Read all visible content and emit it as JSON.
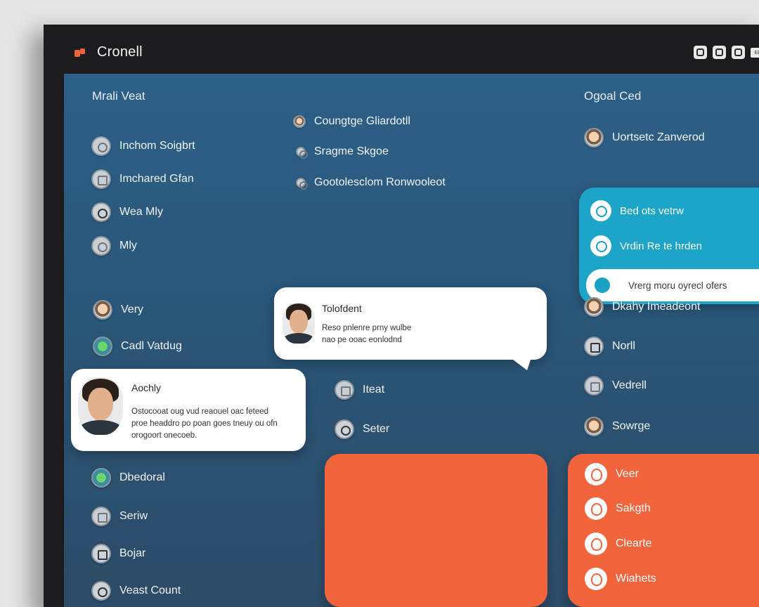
{
  "app": {
    "title": "Cronell"
  },
  "titlebar": {
    "badge_text": "EEE"
  },
  "left": {
    "heading": "Mrali Veat",
    "items": [
      {
        "label": "Inchom Soigbrt",
        "icon": "target-icon"
      },
      {
        "label": "Imchared Gfan",
        "icon": "grid-icon"
      },
      {
        "label": "Wea Mly",
        "icon": "chat-icon"
      },
      {
        "label": "Mly",
        "icon": "circle-icon"
      },
      {
        "label": "Very",
        "icon": "avatar-icon"
      },
      {
        "label": "Cadl Vatdug",
        "icon": "list-icon"
      }
    ],
    "lower_items": [
      {
        "label": "Dbedoral",
        "icon": "green-dot-icon"
      },
      {
        "label": "Seriw",
        "icon": "document-icon"
      },
      {
        "label": "Bojar",
        "icon": "calendar-icon"
      },
      {
        "label": "Veast Count",
        "icon": "counter-icon"
      }
    ]
  },
  "middle": {
    "items": [
      {
        "label": "Coungtge Gliardotll",
        "icon": "avatar-icon"
      },
      {
        "label": "Sragme Skgoe",
        "icon": "gear-icon"
      },
      {
        "label": "Gootolesclom Ronwooleot",
        "icon": "info-icon"
      }
    ],
    "lower_items": [
      {
        "label": "Iteat",
        "icon": "folder-icon"
      },
      {
        "label": "Seter",
        "icon": "settings-icon"
      }
    ]
  },
  "cards": {
    "top": {
      "name": "Tolofdent",
      "lines": [
        "Reso pnlenre prny wulbe",
        "nao pe ooac eonlodnd"
      ]
    },
    "left": {
      "name": "Aochly",
      "lines": [
        "Ostocooat oug vud reaouel oac feteed",
        "proe headdro po poan goes tneuy ou ofn",
        "orogoort onecoeb."
      ]
    }
  },
  "right": {
    "heading": "Ogoal Ced",
    "top_item": {
      "label": "Uortsetc Zanverod",
      "icon": "avatar-icon"
    },
    "teal_items": [
      {
        "label": "Bed ots vetrw",
        "icon": "chat-bubble-icon"
      },
      {
        "label": "Vrdin Re te hrden",
        "icon": "chat-bubble-icon"
      }
    ],
    "teal_pill": "Vrerg moru oyrecl ofers",
    "items": [
      {
        "label": "Dkahy Imeadeont",
        "icon": "avatar-icon"
      },
      {
        "label": "Norll",
        "icon": "window-icon"
      },
      {
        "label": "Vedrell",
        "icon": "document-icon"
      },
      {
        "label": "Sowrge",
        "icon": "badge-icon"
      }
    ]
  },
  "orange_mid": {
    "icons": [
      "flame-icon",
      "figure-icon",
      "leaf-icon",
      "swirl-icon"
    ]
  },
  "orange_right": {
    "items": [
      {
        "label": "Veer",
        "icon": "flame-icon"
      },
      {
        "label": "Sakgth",
        "icon": "leaf-icon"
      },
      {
        "label": "Clearte",
        "icon": "diamond-icon"
      },
      {
        "label": "Wiahets",
        "icon": "heart-icon"
      }
    ]
  },
  "colors": {
    "accent_orange": "#f2643c",
    "accent_teal": "#1ca5c8",
    "panel_blue": "#2d6088",
    "frame": "#1c1c1e"
  }
}
